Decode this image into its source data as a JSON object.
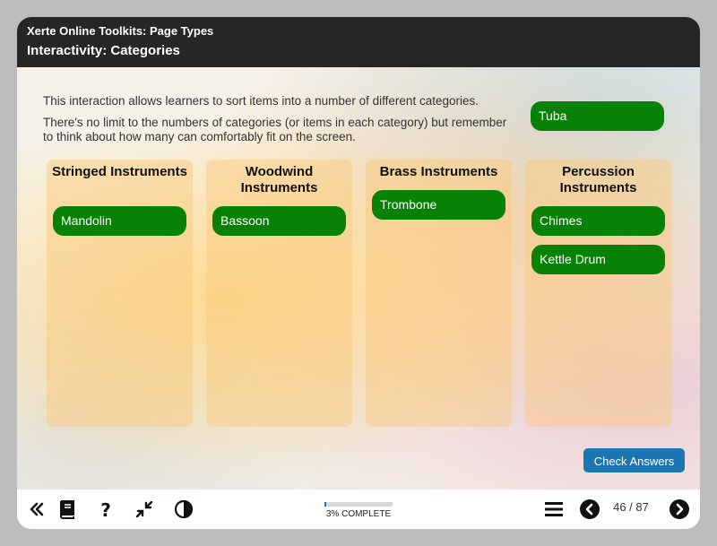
{
  "header": {
    "course_title": "Xerte Online Toolkits: Page Types",
    "page_title": "Interactivity: Categories"
  },
  "intro": {
    "line1": "This interaction allows learners to sort items into a number of different categories.",
    "line2": "There's no limit to the numbers of categories (or items in each category) but remember to think about how many can comfortably fit on the screen."
  },
  "unsorted_items": [
    "Tuba"
  ],
  "categories": [
    {
      "title": "Stringed Instruments",
      "items": [
        "Mandolin"
      ]
    },
    {
      "title": "Woodwind Instruments",
      "items": [
        "Bassoon"
      ]
    },
    {
      "title": "Brass Instruments",
      "items": [
        "Trombone"
      ]
    },
    {
      "title": "Percussion Instruments",
      "items": [
        "Chimes",
        "Kettle Drum"
      ]
    }
  ],
  "check_button_label": "Check Answers",
  "progress": {
    "percent": 3,
    "label": "3% COMPLETE"
  },
  "pagination": {
    "current": 46,
    "total": 87,
    "label": "46 / 87"
  },
  "footer_icons": [
    "rewind-icon",
    "book-icon",
    "help-icon",
    "compress-icon",
    "contrast-icon",
    "menu-icon",
    "previous-icon",
    "next-icon"
  ],
  "colors": {
    "header_bg": "#262626",
    "item_green": "#078207",
    "button_blue": "#1b77b3"
  }
}
